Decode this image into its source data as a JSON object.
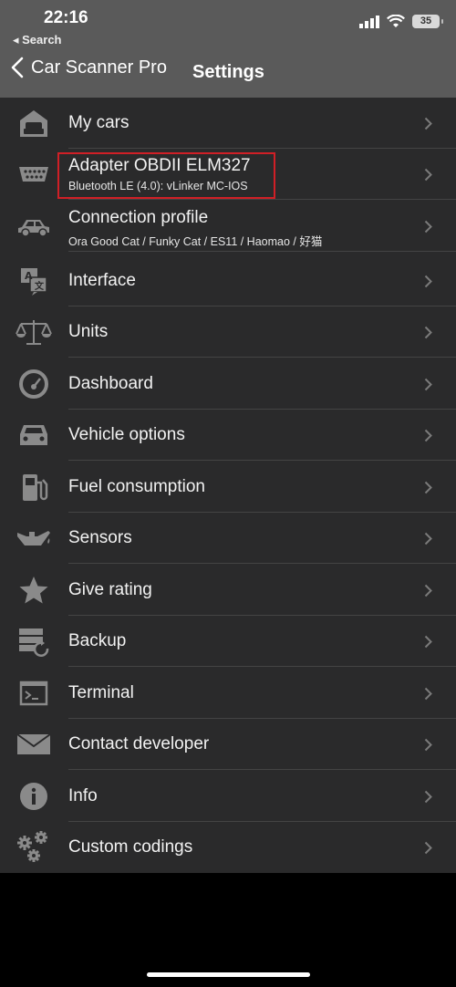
{
  "status_bar": {
    "time": "22:16",
    "back_app": "◂ Search",
    "battery": "35"
  },
  "nav": {
    "back_label": "Car Scanner Pro",
    "title": "Settings"
  },
  "colors": {
    "list_bg": "#2a2a2b",
    "header_bg": "#5a5a5a",
    "highlight": "#d01f26"
  },
  "settings": [
    {
      "label": "My cars",
      "icon": "garage-car-icon"
    },
    {
      "label": "Adapter OBDII ELM327",
      "sub": "Bluetooth LE (4.0): vLinker MC-IOS",
      "icon": "obd-connector-icon",
      "highlighted": true
    },
    {
      "label": "Connection profile",
      "sub": "Ora Good Cat / Funky Cat / ES11 / Haomao / 好猫",
      "icon": "car-side-icon"
    },
    {
      "label": "Interface",
      "icon": "translate-icon"
    },
    {
      "label": "Units",
      "icon": "scales-icon"
    },
    {
      "label": "Dashboard",
      "icon": "gauge-icon"
    },
    {
      "label": "Vehicle options",
      "icon": "car-front-icon"
    },
    {
      "label": "Fuel consumption",
      "icon": "fuel-pump-icon"
    },
    {
      "label": "Sensors",
      "icon": "oil-can-icon"
    },
    {
      "label": "Give rating",
      "icon": "star-icon"
    },
    {
      "label": "Backup",
      "icon": "backup-icon"
    },
    {
      "label": "Terminal",
      "icon": "terminal-icon"
    },
    {
      "label": "Contact developer",
      "icon": "envelope-icon"
    },
    {
      "label": "Info",
      "icon": "info-icon"
    },
    {
      "label": "Custom codings",
      "icon": "gears-icon"
    }
  ]
}
